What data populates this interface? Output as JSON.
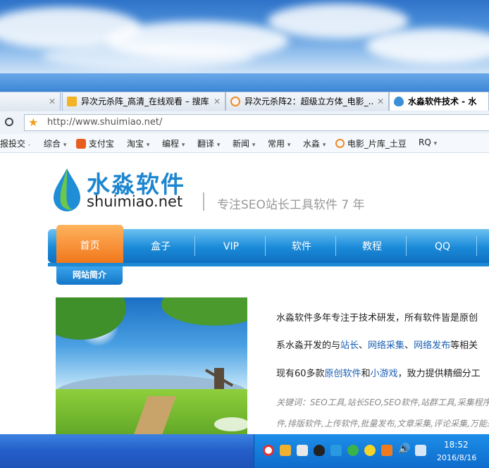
{
  "tabs": [
    {
      "label": "异次元杀阵_高清_在线观看 – 搜库",
      "icon": "soku-icon"
    },
    {
      "label": "异次元杀阵2：超级立方体_电影_...",
      "icon": "tudou-icon"
    },
    {
      "label": "水淼软件技术 - 水",
      "icon": "drop-icon"
    }
  ],
  "address": {
    "url": "http://www.shuimiao.net/"
  },
  "favorites": [
    {
      "label": "报投交",
      "caret": "-"
    },
    {
      "label": "综合",
      "caret": "▾"
    },
    {
      "label": "支付宝",
      "caret": ""
    },
    {
      "label": "淘宝",
      "caret": "▾"
    },
    {
      "label": "编程",
      "caret": "▾"
    },
    {
      "label": "翻译",
      "caret": "▾"
    },
    {
      "label": "新闻",
      "caret": "▾"
    },
    {
      "label": "常用",
      "caret": "▾"
    },
    {
      "label": "水淼",
      "caret": "▾"
    },
    {
      "label": "电影_片库_土豆",
      "caret": ""
    },
    {
      "label": "RQ",
      "caret": "▾"
    }
  ],
  "site": {
    "logo_cn": "水淼软件",
    "logo_en": "shuimiao.net",
    "slogan": "专注SEO站长工具软件 7 年",
    "nav": [
      "首页",
      "盒子",
      "VIP",
      "软件",
      "教程",
      "QQ"
    ],
    "section_title": "网站简介",
    "intro": {
      "line1": "水淼软件多年专注于技术研发，所有软件皆是原创",
      "line2_a": "系水淼开发的与",
      "line2_link1": "站长",
      "line2_sep1": "、",
      "line2_link2": "网络采集",
      "line2_sep2": "、",
      "line2_link3": "网络发布",
      "line2_b": "等相关",
      "line3_a": "现有60多款",
      "line3_link1": "原创软件",
      "line3_b": "和",
      "line3_link2": "小游戏",
      "line3_c": "，致力提供精细分工"
    },
    "keywords_1": "关键词：SEO工具,站长SEO,SEO软件,站群工具,采集程序,",
    "keywords_2": "件,排版软件,上传软件,批量发布,文章采集,评论采集,万能采"
  },
  "taskbar": {
    "time": "18:52",
    "date": "2016/8/16"
  },
  "colors": {
    "accent": "#1a8ad8",
    "home_tab": "#f0771c",
    "link": "#1a5fb4"
  }
}
